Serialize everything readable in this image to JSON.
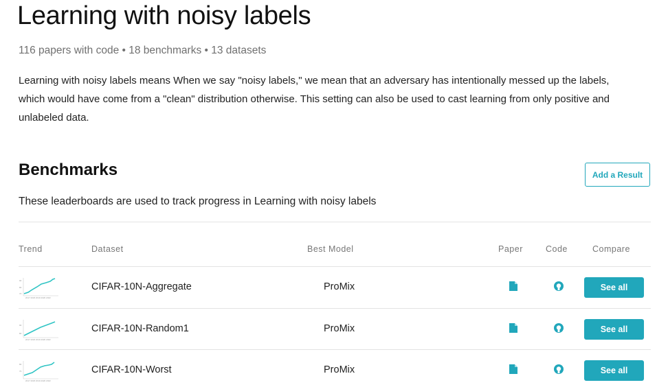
{
  "header": {
    "title": "Learning with noisy labels",
    "meta": "116 papers with code • 18 benchmarks • 13 datasets",
    "description": "Learning with noisy labels means When we say \"noisy labels,\" we mean that an adversary has intentionally messed up the labels, which would have come from a \"clean\" distribution otherwise. This setting can also be used to cast learning from only positive and unlabeled data."
  },
  "benchmarks": {
    "title": "Benchmarks",
    "add_result_label": "Add a Result",
    "subtitle": "These leaderboards are used to track progress in Learning with noisy labels",
    "columns": {
      "trend": "Trend",
      "dataset": "Dataset",
      "best_model": "Best Model",
      "paper": "Paper",
      "code": "Code",
      "compare": "Compare"
    },
    "rows": [
      {
        "dataset": "CIFAR-10N-Aggregate",
        "best_model": "ProMix",
        "compare_label": "See all",
        "paper_icon": "paper-icon",
        "code_icon": "github-icon"
      },
      {
        "dataset": "CIFAR-10N-Random1",
        "best_model": "ProMix",
        "compare_label": "See all",
        "paper_icon": "paper-icon",
        "code_icon": "github-icon"
      },
      {
        "dataset": "CIFAR-10N-Worst",
        "best_model": "ProMix",
        "compare_label": "See all",
        "paper_icon": "paper-icon",
        "code_icon": "github-icon"
      }
    ]
  },
  "colors": {
    "accent": "#21a7bb",
    "trend_line": "#2fc4c4"
  }
}
